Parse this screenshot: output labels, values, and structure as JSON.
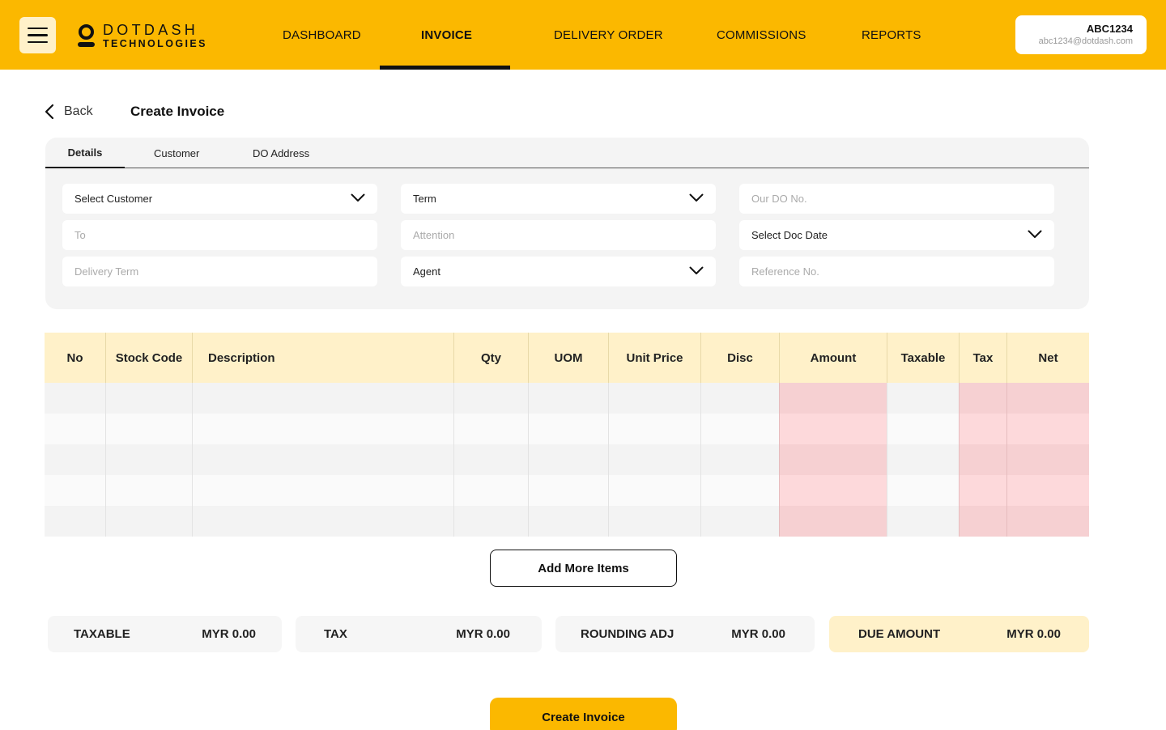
{
  "brand": {
    "line1": "DOTDASH",
    "line2": "TECHNOLOGIES"
  },
  "nav": {
    "items": [
      {
        "label": "DASHBOARD"
      },
      {
        "label": "INVOICE"
      },
      {
        "label": "DELIVERY ORDER"
      },
      {
        "label": "COMMISSIONS"
      },
      {
        "label": "REPORTS"
      }
    ],
    "active": "INVOICE"
  },
  "user": {
    "name": "ABC1234",
    "email": "abc1234@dotdash.com"
  },
  "header": {
    "back_label": "Back",
    "title": "Create Invoice"
  },
  "tabs": [
    {
      "label": "Details"
    },
    {
      "label": "Customer"
    },
    {
      "label": "DO Address"
    }
  ],
  "form": {
    "select_customer": "Select Customer",
    "to_placeholder": "To",
    "delivery_term_placeholder": "Delivery Term",
    "term": "Term",
    "attention_placeholder": "Attention",
    "agent": "Agent",
    "our_do_no_placeholder": "Our DO No.",
    "select_doc_date": "Select Doc Date",
    "reference_no_placeholder": "Reference No."
  },
  "table": {
    "columns": [
      "No",
      "Stock Code",
      "Description",
      "Qty",
      "UOM",
      "Unit Price",
      "Disc",
      "Amount",
      "Taxable",
      "Tax",
      "Net"
    ],
    "rows": 5
  },
  "add_more_label": "Add More Items",
  "totals": {
    "taxable_label": "TAXABLE",
    "taxable_value": "MYR 0.00",
    "tax_label": "TAX",
    "tax_value": "MYR 0.00",
    "rounding_label": "ROUNDING ADJ",
    "rounding_value": "MYR 0.00",
    "due_label": "DUE AMOUNT",
    "due_value": "MYR 0.00"
  },
  "create_label": "Create Invoice",
  "colors": {
    "brand_yellow": "#FBB800",
    "light_yellow": "#FFF1C9",
    "highlight_pink": "#F6D0D2"
  }
}
